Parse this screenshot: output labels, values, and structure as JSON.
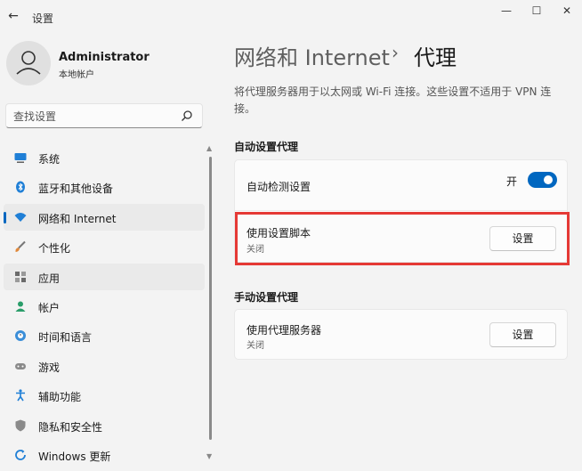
{
  "window": {
    "title": "设置",
    "back_glyph": "←",
    "minimize_glyph": "—",
    "maximize_glyph": "☐",
    "close_glyph": "✕"
  },
  "user": {
    "name": "Administrator",
    "account_type": "本地帐户"
  },
  "search": {
    "placeholder": "查找设置"
  },
  "sidebar": {
    "items": [
      {
        "label": "系统",
        "icon": "monitor-icon"
      },
      {
        "label": "蓝牙和其他设备",
        "icon": "bluetooth-icon"
      },
      {
        "label": "网络和 Internet",
        "icon": "wifi-icon",
        "selected": true
      },
      {
        "label": "个性化",
        "icon": "brush-icon"
      },
      {
        "label": "应用",
        "icon": "apps-icon"
      },
      {
        "label": "帐户",
        "icon": "person-icon"
      },
      {
        "label": "时间和语言",
        "icon": "globe-clock-icon"
      },
      {
        "label": "游戏",
        "icon": "gamepad-icon"
      },
      {
        "label": "辅助功能",
        "icon": "accessibility-icon"
      },
      {
        "label": "隐私和安全性",
        "icon": "shield-icon"
      },
      {
        "label": "Windows 更新",
        "icon": "windows-update-icon"
      }
    ]
  },
  "breadcrumb": {
    "parent": "网络和 Internet",
    "separator": "›",
    "current": "代理"
  },
  "description": "将代理服务器用于以太网或 Wi-Fi 连接。这些设置不适用于 VPN 连接。",
  "auto_proxy": {
    "heading": "自动设置代理",
    "detect": {
      "label": "自动检测设置",
      "state_label": "开",
      "on": true
    },
    "script": {
      "label": "使用设置脚本",
      "status": "关闭",
      "button": "设置"
    }
  },
  "manual_proxy": {
    "heading": "手动设置代理",
    "server": {
      "label": "使用代理服务器",
      "status": "关闭",
      "button": "设置"
    }
  },
  "colors": {
    "accent": "#0067c0",
    "highlight": "#e53935",
    "background": "#f3f3f3"
  }
}
